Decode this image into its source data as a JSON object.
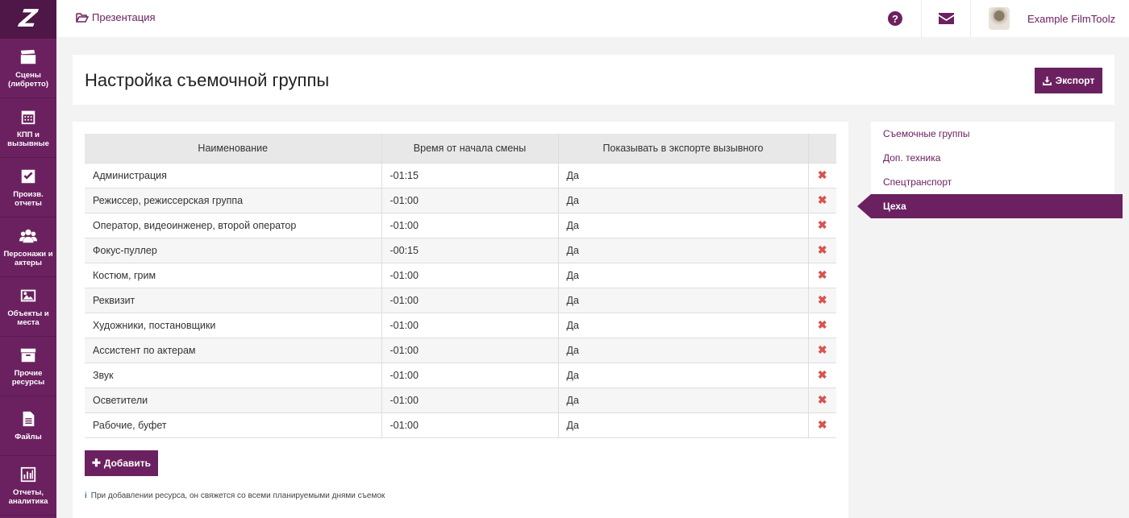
{
  "sidebar": {
    "logo": "Z",
    "items": [
      {
        "label": "Сцены\n(либретто)",
        "icon": "clapperboard-icon"
      },
      {
        "label": "КПП и\nвызывные",
        "icon": "calendar-icon"
      },
      {
        "label": "Произв.\nотчеты",
        "icon": "check-square-icon"
      },
      {
        "label": "Персонажи и\nактеры",
        "icon": "users-icon"
      },
      {
        "label": "Объекты и\nместа",
        "icon": "image-icon"
      },
      {
        "label": "Прочие\nресурсы",
        "icon": "archive-icon"
      },
      {
        "label": "Файлы",
        "icon": "file-icon"
      },
      {
        "label": "Отчеты,\nаналитика",
        "icon": "bar-chart-icon"
      }
    ]
  },
  "topbar": {
    "project": "Презентация",
    "help_icon": "?",
    "user_name": "Example FilmToolz"
  },
  "header": {
    "title": "Настройка съемочной группы",
    "export_label": "Экспорт"
  },
  "table": {
    "columns": [
      "Наименование",
      "Время от начала смены",
      "Показывать в экспорте вызывного"
    ],
    "rows": [
      {
        "name": "Администрация",
        "time": "-01:15",
        "show": "Да"
      },
      {
        "name": "Режиссер, режиссерская группа",
        "time": "-01:00",
        "show": "Да"
      },
      {
        "name": "Оператор, видеоинженер, второй оператор",
        "time": "-01:00",
        "show": "Да"
      },
      {
        "name": "Фокус-пуллер",
        "time": "-00:15",
        "show": "Да"
      },
      {
        "name": "Костюм, грим",
        "time": "-01:00",
        "show": "Да"
      },
      {
        "name": "Реквизит",
        "time": "-01:00",
        "show": "Да"
      },
      {
        "name": "Художники, постановщики",
        "time": "-01:00",
        "show": "Да"
      },
      {
        "name": "Ассистент по актерам",
        "time": "-01:00",
        "show": "Да"
      },
      {
        "name": "Звук",
        "time": "-01:00",
        "show": "Да"
      },
      {
        "name": "Осветители",
        "time": "-01:00",
        "show": "Да"
      },
      {
        "name": "Рабочие, буфет",
        "time": "-01:00",
        "show": "Да"
      }
    ],
    "delete_glyph": "✖"
  },
  "add_label": "Добавить",
  "hint": "При добавлении ресурса, он свяжется со всеми планируемыми днями съемок",
  "right_nav": {
    "items": [
      "Съемочные группы",
      "Доп. техника",
      "Спецтранспорт",
      "Цеха"
    ],
    "active": "Цеха"
  },
  "colors": {
    "brand": "#6b2160",
    "delete": "#d9534f"
  }
}
